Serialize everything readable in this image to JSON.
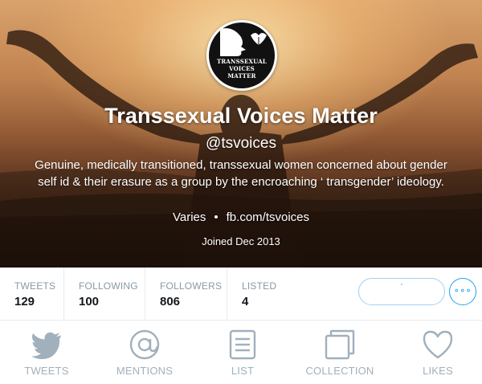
{
  "profile": {
    "avatar_text": [
      "TRANSSEXUAL",
      "VOICES",
      "MATTER"
    ],
    "name": "Transsexual Voices Matter",
    "handle": "@tsvoices",
    "bio": "Genuine, medically transitioned, transsexual women concerned about gender self id & their erasure as a group by the encroaching ‘ transgender’ ideology.",
    "location": "Varies",
    "separator": "•",
    "website": "fb.com/tsvoices",
    "joined": "Joined Dec 2013"
  },
  "stats": [
    {
      "label": "TWEETS",
      "value": "129"
    },
    {
      "label": "FOLLOWING",
      "value": "100"
    },
    {
      "label": "FOLLOWERS",
      "value": "806"
    },
    {
      "label": "LISTED",
      "value": "4"
    }
  ],
  "actions": {
    "more_label": "∘∘∘"
  },
  "nav": [
    {
      "label": "TWEETS",
      "icon": "bird-icon"
    },
    {
      "label": "MENTIONS",
      "icon": "at-icon"
    },
    {
      "label": "LIST",
      "icon": "list-icon"
    },
    {
      "label": "COLLECTION",
      "icon": "collection-icon"
    },
    {
      "label": "LIKES",
      "icon": "heart-icon"
    }
  ],
  "colors": {
    "accent": "#1da1f2",
    "muted": "#a0b0bd",
    "stat_label": "#8899a6"
  }
}
